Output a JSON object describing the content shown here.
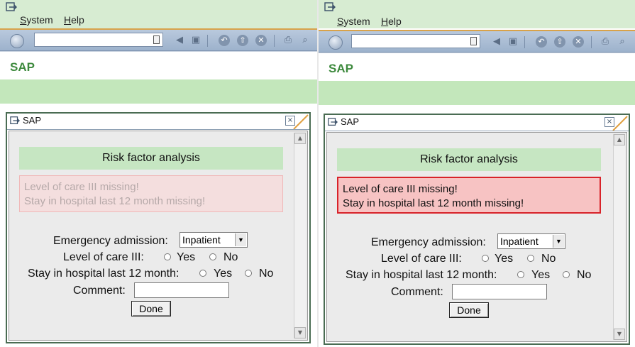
{
  "left": {
    "menu": {
      "system": "System",
      "help": "Help"
    },
    "app_title": "SAP",
    "dialog": {
      "title": "SAP",
      "close": "×",
      "header": "Risk factor analysis",
      "messages": [
        "Level of care III missing!",
        "Stay in hospital last 12 month missing!"
      ],
      "emergency_label": "Emergency admission:",
      "emergency_value": "Inpatient",
      "care_label": "Level of care III:",
      "stay_label": "Stay in hospital last 12 month:",
      "yes": "Yes",
      "no": "No",
      "comment_label": "Comment:",
      "done": "Done"
    }
  },
  "right": {
    "menu": {
      "system": "System",
      "help": "Help"
    },
    "app_title": "SAP",
    "dialog": {
      "title": "SAP",
      "close": "×",
      "header": "Risk factor analysis",
      "messages": [
        "Level of care III missing!",
        "Stay in hospital last 12 month missing!"
      ],
      "emergency_label": "Emergency admission:",
      "emergency_value": "Inpatient",
      "care_label": "Level of care III:",
      "stay_label": "Stay in hospital last 12 month:",
      "yes": "Yes",
      "no": "No",
      "comment_label": "Comment:",
      "done": "Done"
    }
  },
  "colors": {
    "menubar_bg": "#d7ecd2",
    "app_title": "#3e8a3e",
    "header_bg": "#c6e6c2",
    "error_border": "#d8232a",
    "error_bg": "#f7c3c3",
    "error_faded_bg": "#f4dede"
  }
}
